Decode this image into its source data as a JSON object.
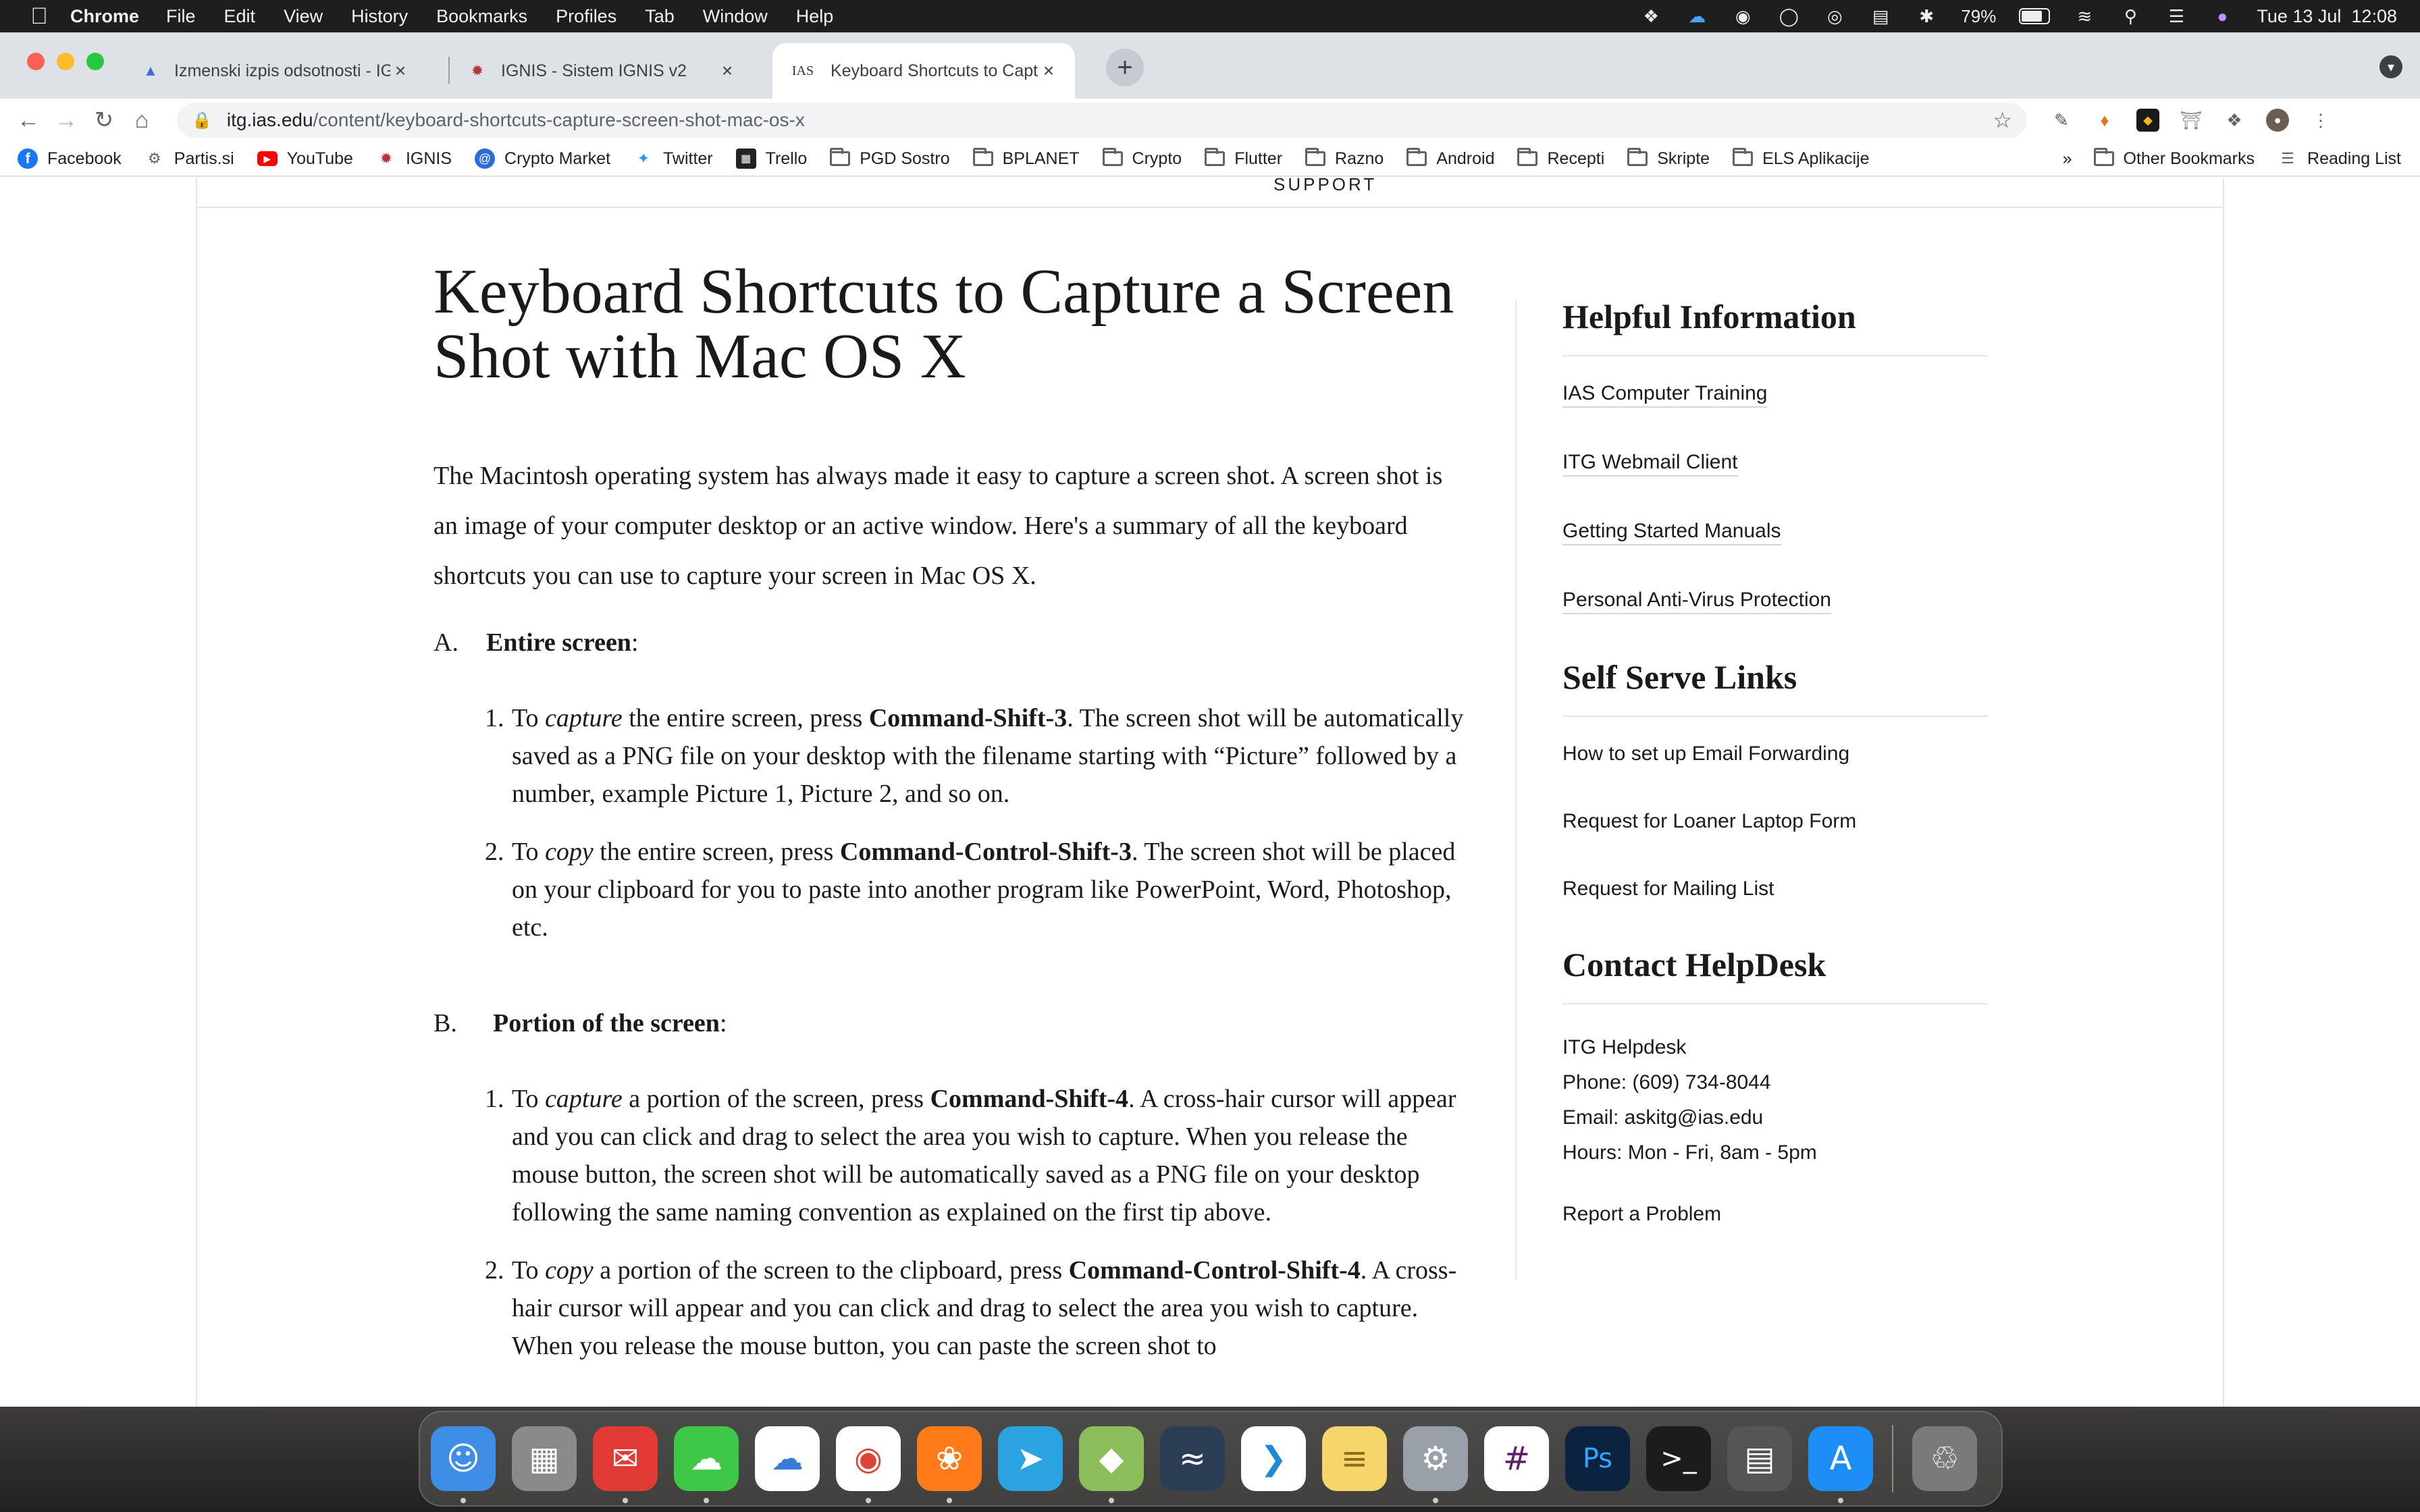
{
  "menubar": {
    "app_name": "Chrome",
    "items": [
      "File",
      "Edit",
      "View",
      "History",
      "Bookmarks",
      "Profiles",
      "Tab",
      "Window",
      "Help"
    ],
    "battery": "79%",
    "datetime": "Tue 13 Jul  12:08"
  },
  "tabs": [
    {
      "title": "Izmenski izpis odsotnosti - IGNIS",
      "favicon": "blue-hat-icon"
    },
    {
      "title": "IGNIS - Sistem IGNIS v2",
      "favicon": "ignis-flame-icon"
    },
    {
      "title": "Keyboard Shortcuts to Capture a Screen Shot",
      "favicon": "ias-logo",
      "favicon_text": "IAS"
    }
  ],
  "toolbar": {
    "url_host": "itg.ias.edu",
    "url_path": "/content/keyboard-shortcuts-capture-screen-shot-mac-os-x"
  },
  "bookmarks": {
    "items": [
      {
        "label": "Facebook",
        "icon": "facebook-icon"
      },
      {
        "label": "Partis.si",
        "icon": "globe-icon"
      },
      {
        "label": "YouTube",
        "icon": "youtube-icon"
      },
      {
        "label": "IGNIS",
        "icon": "ignis-flame-icon"
      },
      {
        "label": "Crypto Market",
        "icon": "crypto-market-icon"
      },
      {
        "label": "Twitter",
        "icon": "twitter-icon"
      },
      {
        "label": "Trello",
        "icon": "trello-icon"
      },
      {
        "label": "PGD Sostro",
        "icon": "folder-icon"
      },
      {
        "label": "BPLANET",
        "icon": "folder-icon"
      },
      {
        "label": "Crypto",
        "icon": "folder-icon"
      },
      {
        "label": "Flutter",
        "icon": "folder-icon"
      },
      {
        "label": "Razno",
        "icon": "folder-icon"
      },
      {
        "label": "Android",
        "icon": "folder-icon"
      },
      {
        "label": "Recepti",
        "icon": "folder-icon"
      },
      {
        "label": "Skripte",
        "icon": "folder-icon"
      },
      {
        "label": "ELS Aplikacije",
        "icon": "folder-icon"
      }
    ],
    "overflow": "»",
    "other": "Other Bookmarks",
    "reading_list": "Reading List"
  },
  "page": {
    "support": "SUPPORT",
    "title": "Keyboard Shortcuts to Capture a Screen Shot with Mac OS X",
    "intro": "The Macintosh operating system has always made it easy to capture a screen shot. A screen shot is an image of your computer desktop or an active window.  Here's a summary of all the keyboard shortcuts you can use to capture your screen in Mac OS X.",
    "sections": [
      {
        "letter": "A.",
        "heading": "Entire screen",
        "items": [
          {
            "num": "1.",
            "pre": "To ",
            "em": "capture",
            "mid": " the entire screen, press ",
            "strong": "Command-Shift-3",
            "post": ". The screen shot will be automatically saved as a PNG file on your desktop with the filename starting with “Picture” followed by a number, example Picture 1, Picture 2, and so on."
          },
          {
            "num": "2.",
            "pre": "To ",
            "em": "copy",
            "mid": " the entire screen, press ",
            "strong": "Command-Control-Shift-3",
            "post": ". The screen shot will be placed on your clipboard for you to paste into another program like PowerPoint, Word, Photoshop, etc."
          }
        ]
      },
      {
        "letter": "B.",
        "heading": "Portion of the screen",
        "items": [
          {
            "num": "1.",
            "pre": "To ",
            "em": "capture",
            "mid": " a portion of the screen, press ",
            "strong": "Command-Shift-4",
            "post": ". A cross-hair cursor will appear and you can click and drag to select the area you wish to capture. When you release the mouse button, the screen shot will be automatically saved as a PNG file on your desktop following the same naming convention as explained on the first tip above."
          },
          {
            "num": "2.",
            "pre": "To ",
            "em": "copy",
            "mid": " a portion of the screen to the clipboard, press ",
            "strong": "Command-Control-Shift-4",
            "post": ".  A cross-hair cursor will appear and you can click and drag to select the area you wish to capture. When you release the mouse button, you can paste the screen shot to"
          }
        ]
      }
    ]
  },
  "sidebar": {
    "helpful_title": "Helpful Information",
    "helpful_links": [
      "IAS Computer Training",
      "ITG Webmail Client",
      "Getting Started Manuals",
      "Personal Anti-Virus Protection"
    ],
    "self_serve_title": "Self Serve Links",
    "self_serve_links": [
      "How to set up Email Forwarding",
      "Request for Loaner Laptop Form",
      "Request for Mailing List"
    ],
    "contact_title": "Contact HelpDesk",
    "contact_name": "ITG Helpdesk",
    "contact_phone": "Phone: (609) 734-8044",
    "contact_email": "Email: askitg@ias.edu",
    "contact_hours": "Hours: Mon - Fri, 8am - 5pm",
    "report": "Report a Problem"
  },
  "dock": [
    {
      "name": "finder-icon",
      "color": "#3e8ee8",
      "running": true
    },
    {
      "name": "launchpad-icon",
      "color": "#8a8a8a",
      "running": false
    },
    {
      "name": "mail-icon",
      "color": "#e23a35",
      "running": true
    },
    {
      "name": "messages-icon",
      "color": "#3ec847",
      "running": true
    },
    {
      "name": "cloud-app-icon",
      "color": "#ffffff",
      "running": false
    },
    {
      "name": "chrome-icon",
      "color": "#ffffff",
      "running": true
    },
    {
      "name": "firefox-icon",
      "color": "#ff7a18",
      "running": true
    },
    {
      "name": "telegram-icon",
      "color": "#2aa3e0",
      "running": false
    },
    {
      "name": "box-app-icon",
      "color": "#8bbd5a",
      "running": true
    },
    {
      "name": "mysql-workbench-icon",
      "color": "#2c3e55",
      "running": false
    },
    {
      "name": "vscode-icon",
      "color": "#ffffff",
      "running": false
    },
    {
      "name": "notes-icon",
      "color": "#f6d66b",
      "running": false
    },
    {
      "name": "system-preferences-icon",
      "color": "#9aa0a8",
      "running": true
    },
    {
      "name": "slack-icon",
      "color": "#ffffff",
      "running": false
    },
    {
      "name": "photoshop-icon",
      "color": "#0c2340",
      "running": false
    },
    {
      "name": "terminal-icon",
      "color": "#1c1c1c",
      "running": false
    },
    {
      "name": "calculator-icon",
      "color": "#555555",
      "running": false
    },
    {
      "name": "app-store-icon",
      "color": "#1c8ef5",
      "running": true
    },
    {
      "name": "trash-icon",
      "color": "#7a7a7a",
      "running": false
    }
  ]
}
